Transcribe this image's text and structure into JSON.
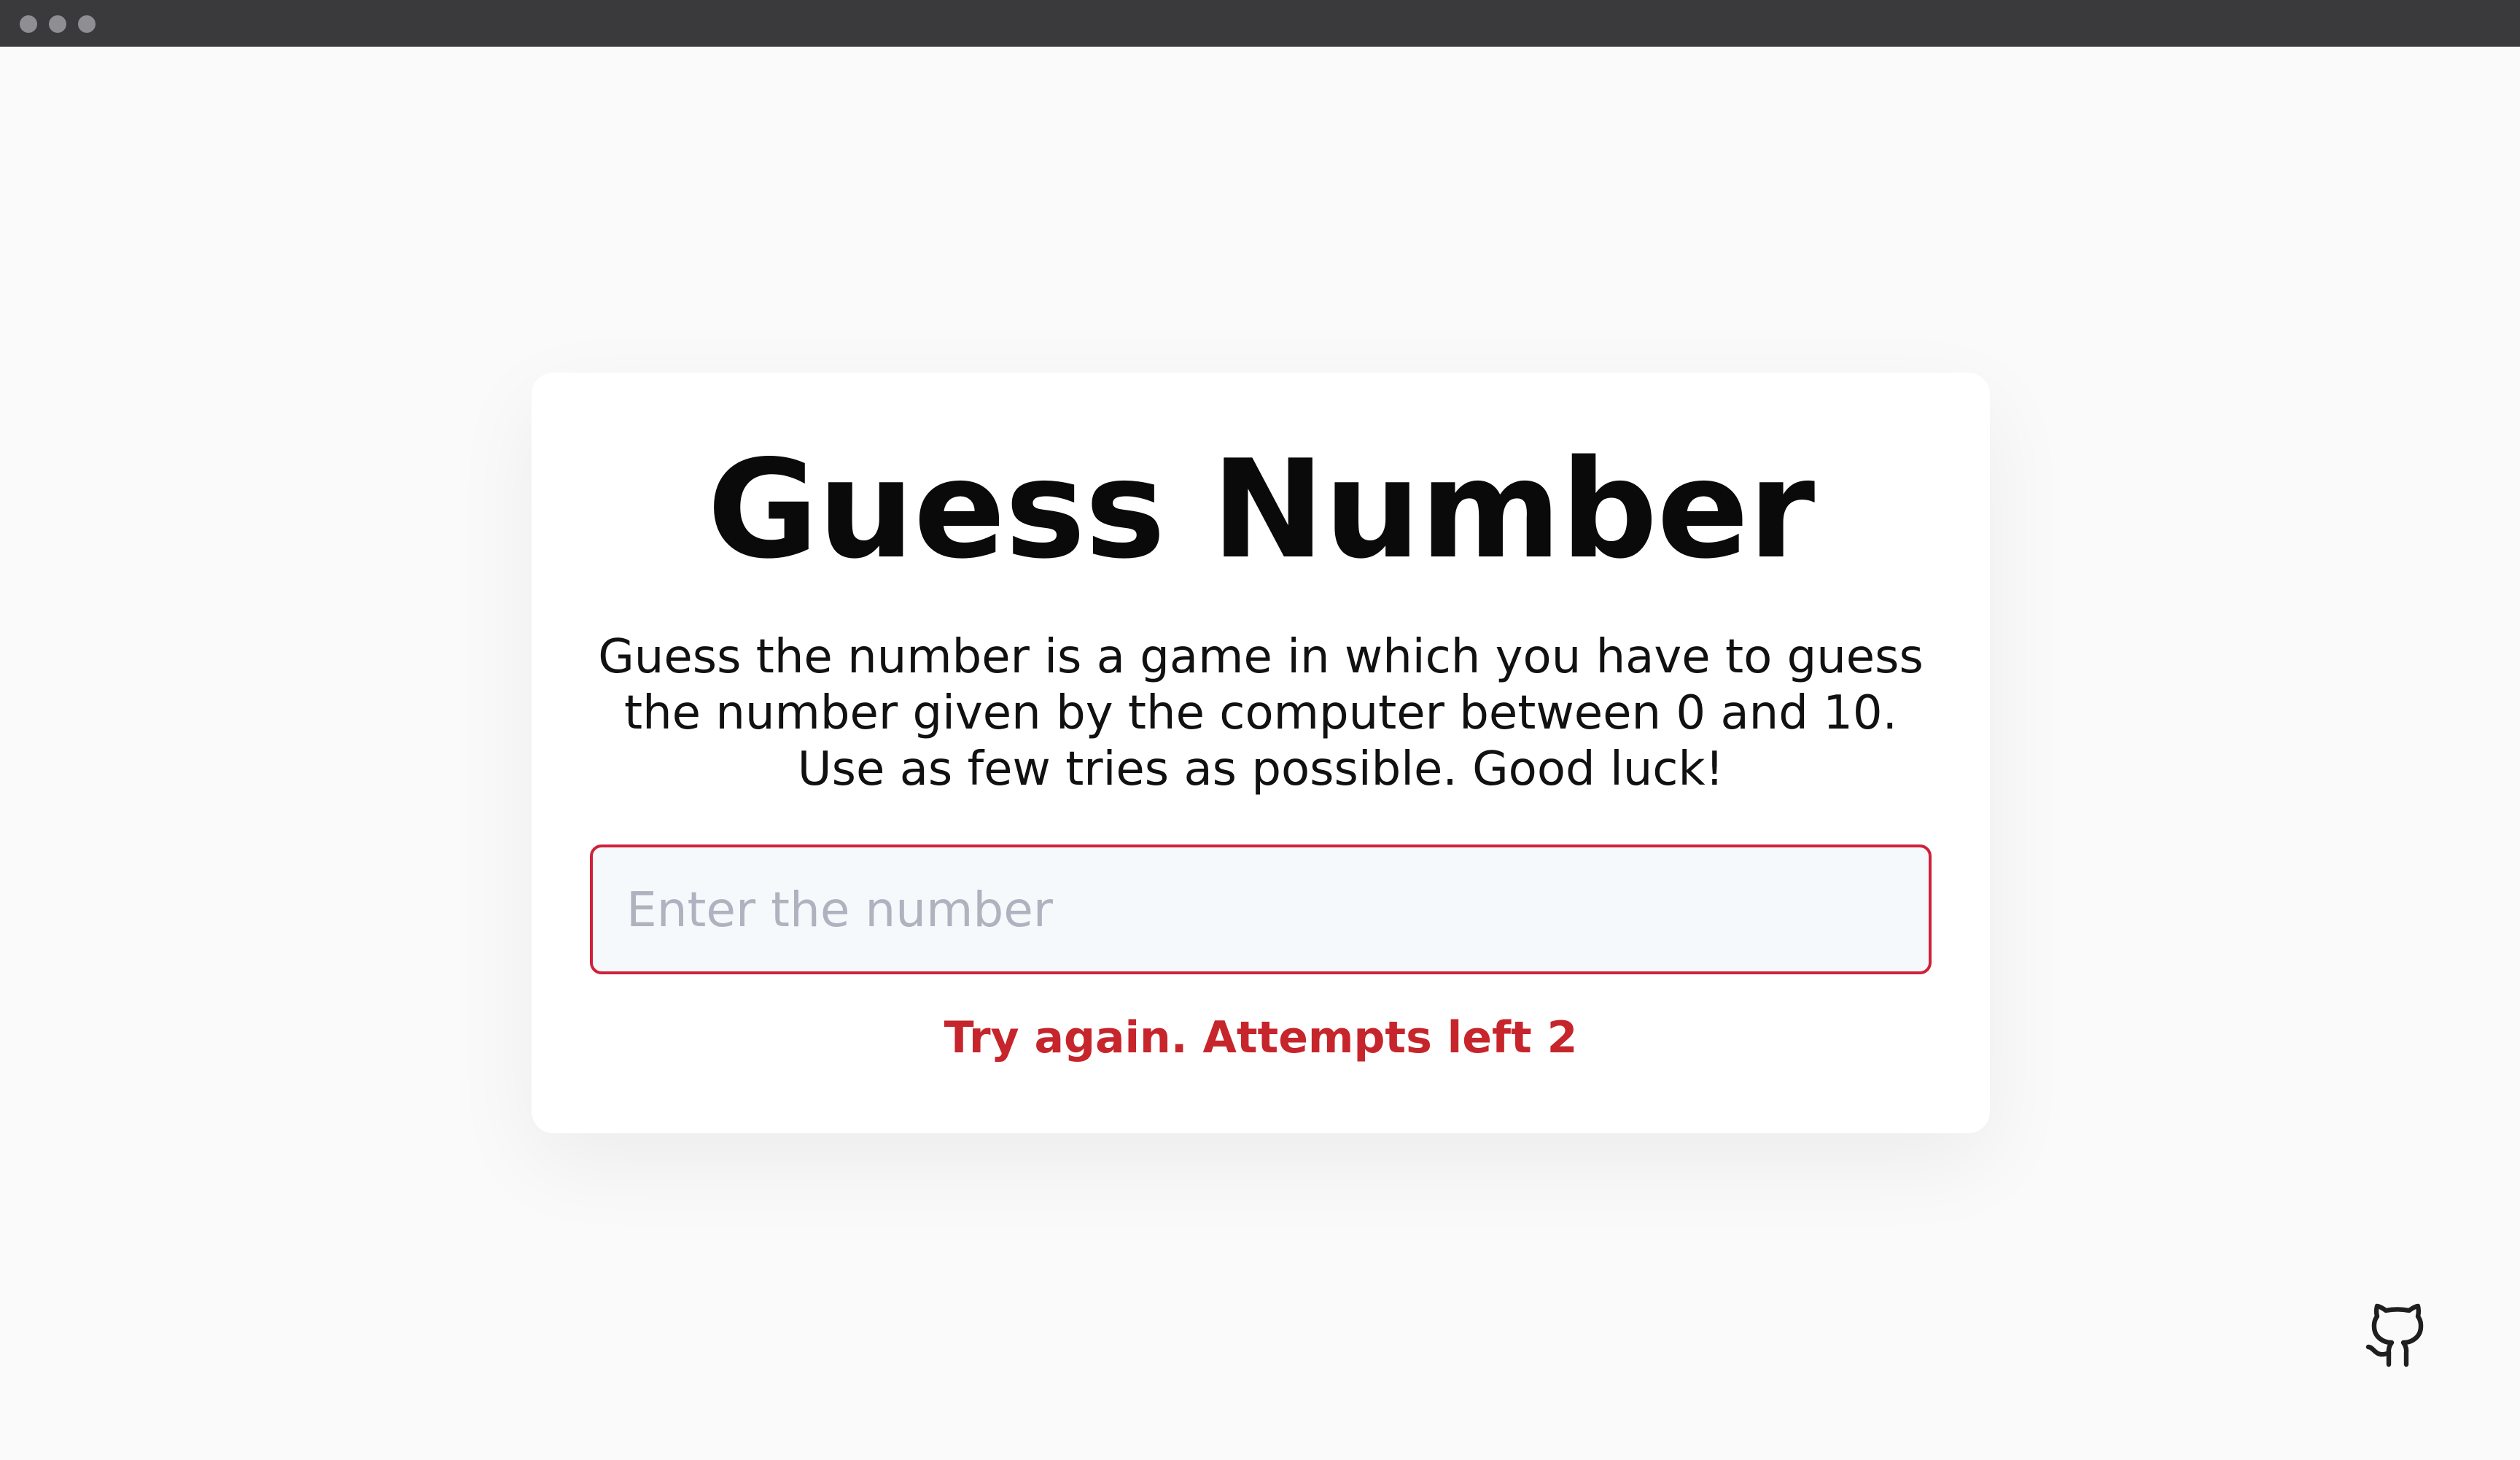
{
  "window": {
    "controls": [
      "dot",
      "dot",
      "dot"
    ]
  },
  "card": {
    "title": "Guess Number",
    "description": "Guess the number is a game in which you have to guess the number given by the computer between 0 and 10. Use as few tries as possible. Good luck!",
    "input": {
      "value": "",
      "placeholder": "Enter the number",
      "border_color": "#d0203a"
    },
    "feedback": "Try again. Attempts left 2",
    "feedback_color": "#c6252c"
  },
  "footer": {
    "github_icon": "github-icon"
  }
}
